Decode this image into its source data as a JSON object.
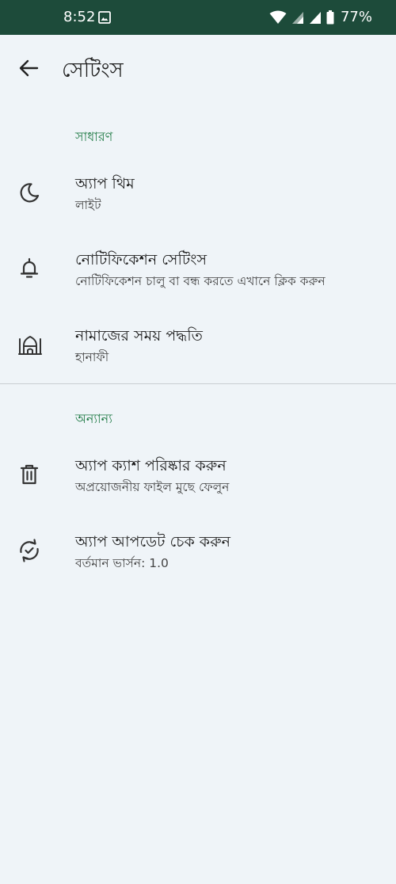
{
  "status_bar": {
    "time": "8:52",
    "battery": "77%"
  },
  "header": {
    "title": "সেটিংস"
  },
  "sections": [
    {
      "header": "সাধারণ",
      "items": [
        {
          "icon": "moon-icon",
          "title": "অ্যাপ থিম",
          "subtitle": "লাইট"
        },
        {
          "icon": "bell-icon",
          "title": "নোটিফিকেশন সেটিংস",
          "subtitle": "নোটিফিকেশন চালু বা বন্ধ করতে এখানে ক্লিক করুন"
        },
        {
          "icon": "mosque-icon",
          "title": "নামাজের সময় পদ্ধতি",
          "subtitle": "হানাফী"
        }
      ]
    },
    {
      "header": "অন্যান্য",
      "items": [
        {
          "icon": "trash-icon",
          "title": "অ্যাপ ক্যাশ পরিষ্কার করুন",
          "subtitle": "অপ্রয়োজনীয় ফাইল মুছে ফেলুন"
        },
        {
          "icon": "update-icon",
          "title": "অ্যাপ আপডেট চেক করুন",
          "subtitle": "বর্তমান ভার্সন: 1.0"
        }
      ]
    }
  ],
  "colors": {
    "status_bar": "#1d4b3a",
    "background": "#eff4f8",
    "accent": "#1f7a45"
  }
}
